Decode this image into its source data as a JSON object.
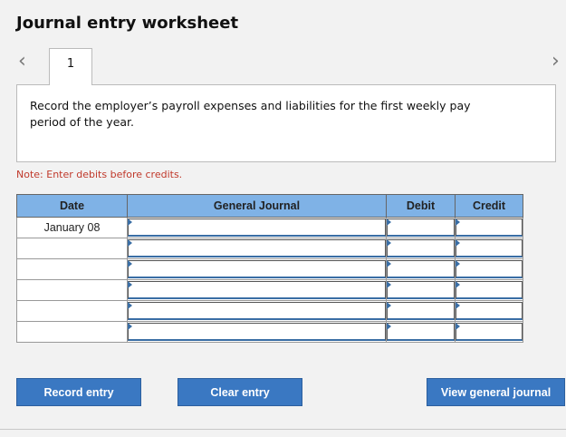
{
  "title": "Journal entry worksheet",
  "tab_number": "1",
  "instruction": "Record the employer’s payroll expenses and liabilities for the first weekly pay period of the year.",
  "note": "Note: Enter debits before credits.",
  "table": {
    "headers": [
      "Date",
      "General Journal",
      "Debit",
      "Credit"
    ],
    "rows": [
      {
        "date": "January 08"
      },
      {
        "date": ""
      },
      {
        "date": ""
      },
      {
        "date": ""
      },
      {
        "date": ""
      },
      {
        "date": ""
      }
    ]
  },
  "buttons": {
    "record": "Record entry",
    "clear": "Clear entry",
    "view": "View general journal"
  },
  "icons": {
    "prev": "chevron-left-icon",
    "next": "chevron-right-icon"
  },
  "colors": {
    "header_bg": "#7fb2e6",
    "button_bg": "#3a78c2",
    "note": "#c0392b"
  }
}
